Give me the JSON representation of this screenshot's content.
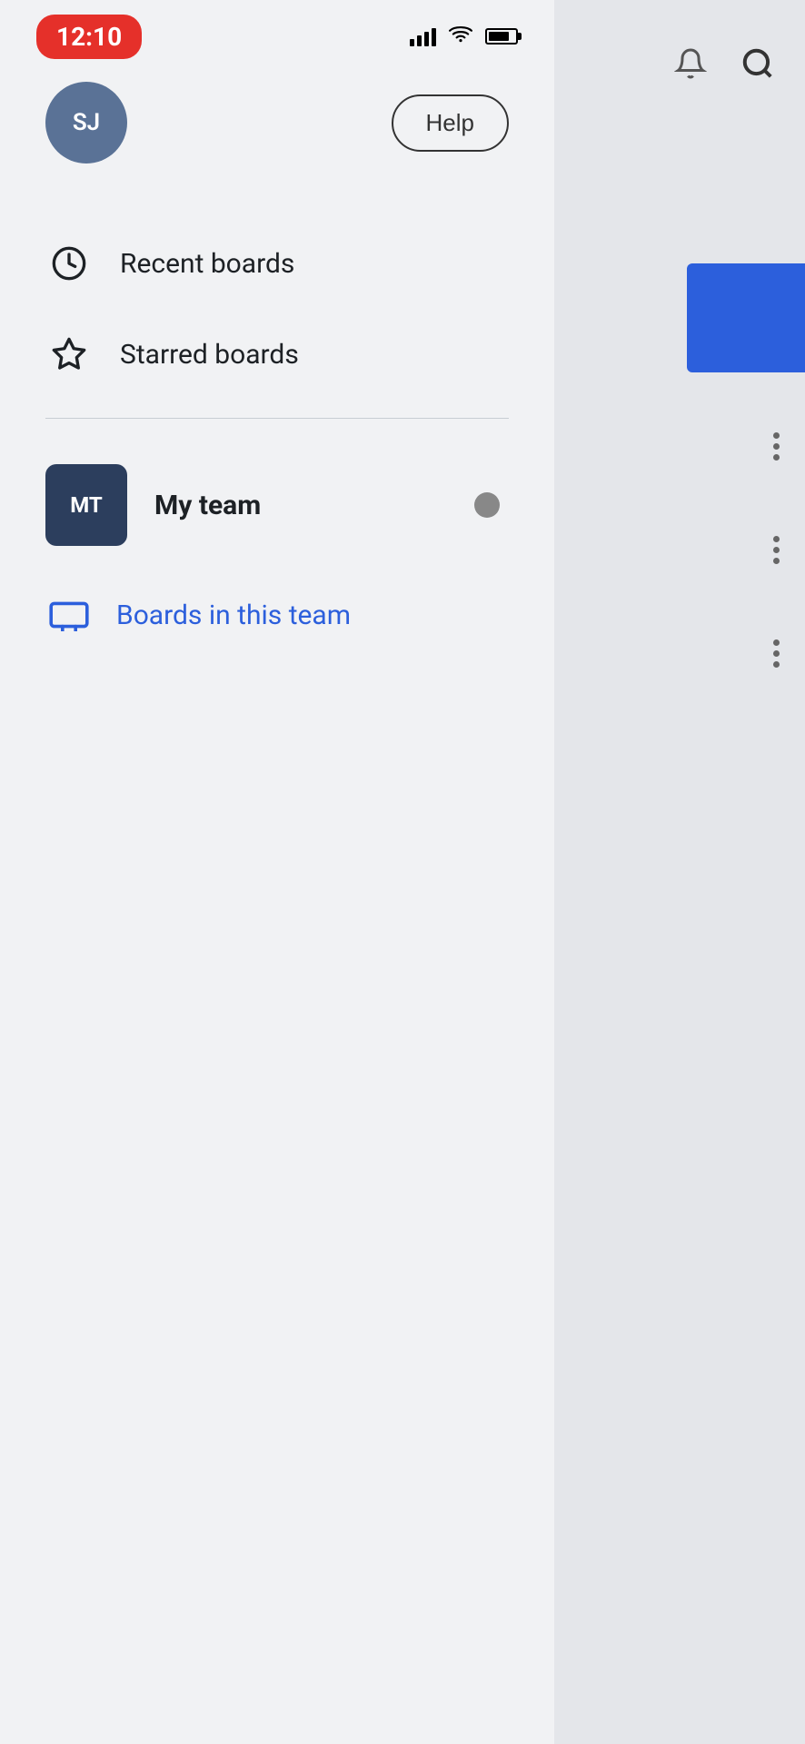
{
  "statusBar": {
    "time": "12:10"
  },
  "header": {
    "avatarInitials": "SJ",
    "helpLabel": "Help"
  },
  "menu": {
    "recentBoards": "Recent boards",
    "starredBoards": "Starred boards"
  },
  "team": {
    "initials": "MT",
    "name": "My team",
    "boardsLink": "Boards in this team"
  },
  "colors": {
    "accent": "#2c5fdc",
    "teamAvatar": "#2c3e5d",
    "userAvatar": "#5a7296",
    "menuIcon": "#1d2125",
    "linkColor": "#2c5fdc"
  }
}
